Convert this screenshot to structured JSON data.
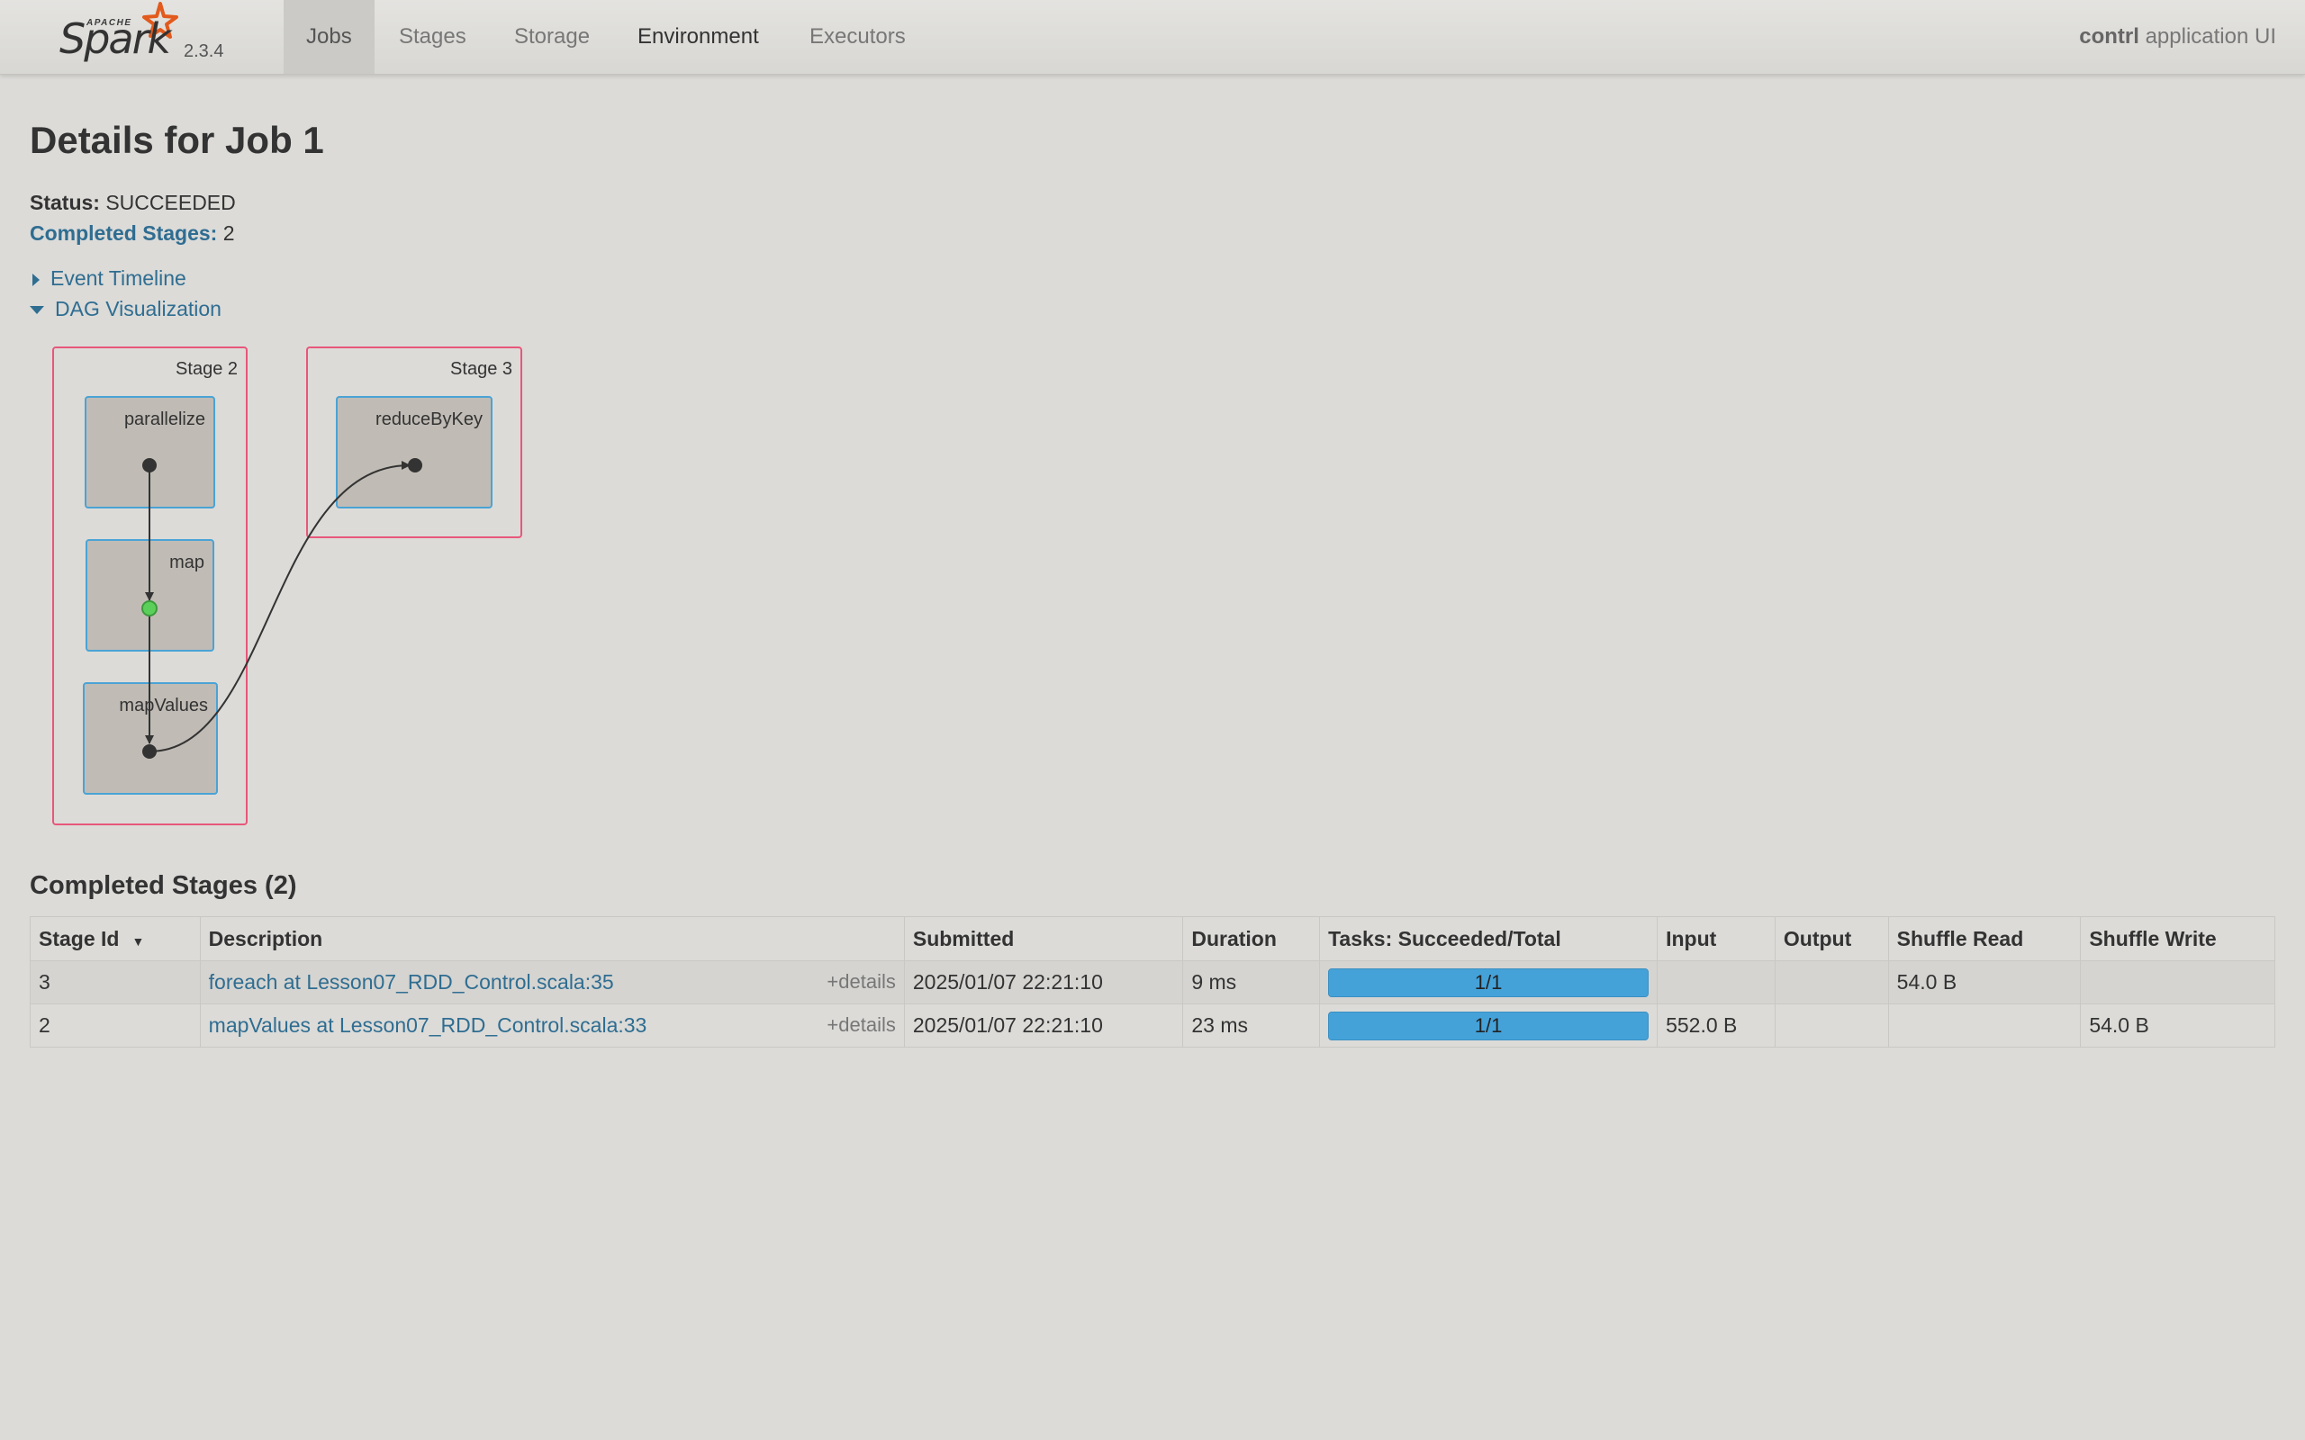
{
  "brand": {
    "top_word": "APACHE",
    "name": "Spark",
    "version": "2.3.4"
  },
  "nav": {
    "tabs": [
      {
        "label": "Jobs"
      },
      {
        "label": "Stages"
      },
      {
        "label": "Storage"
      },
      {
        "label": "Environment"
      },
      {
        "label": "Executors"
      }
    ],
    "active_tab": "Jobs",
    "app_name_bold": "contrl",
    "app_name_rest": " application UI"
  },
  "page": {
    "title": "Details for Job 1",
    "status_label": "Status:",
    "status_value": "SUCCEEDED",
    "completed_stages_label": "Completed Stages:",
    "completed_stages_value": "2",
    "event_timeline_label": "Event Timeline",
    "dag_label": "DAG Visualization"
  },
  "dag": {
    "stages": [
      {
        "label": "Stage 2",
        "operations": [
          "parallelize",
          "map",
          "mapValues"
        ]
      },
      {
        "label": "Stage 3",
        "operations": [
          "reduceByKey"
        ]
      }
    ]
  },
  "completed_stages": {
    "title": "Completed Stages (2)",
    "columns": [
      "Stage Id",
      "Description",
      "Submitted",
      "Duration",
      "Tasks: Succeeded/Total",
      "Input",
      "Output",
      "Shuffle Read",
      "Shuffle Write"
    ],
    "details_label": "+details",
    "rows": [
      {
        "stage_id": "3",
        "description": "foreach at Lesson07_RDD_Control.scala:35",
        "submitted": "2025/01/07 22:21:10",
        "duration": "9 ms",
        "tasks": "1/1",
        "tasks_fraction": 1.0,
        "input": "",
        "output": "",
        "shuffle_read": "54.0 B",
        "shuffle_write": ""
      },
      {
        "stage_id": "2",
        "description": "mapValues at Lesson07_RDD_Control.scala:33",
        "submitted": "2025/01/07 22:21:10",
        "duration": "23 ms",
        "tasks": "1/1",
        "tasks_fraction": 1.0,
        "input": "552.0 B",
        "output": "",
        "shuffle_read": "",
        "shuffle_write": "54.0 B"
      }
    ]
  },
  "colors": {
    "link": "#2f6d91",
    "stage_border": "#e8577a",
    "op_border": "#4aa3d5",
    "progress": "#45a2d9",
    "highlight_node": "#5ad05a"
  }
}
